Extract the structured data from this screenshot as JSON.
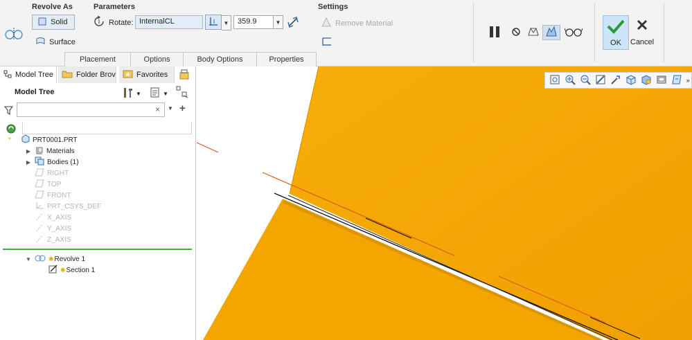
{
  "ribbon": {
    "revolve_as": {
      "title": "Revolve As",
      "solid_label": "Solid",
      "surface_label": "Surface"
    },
    "parameters": {
      "title": "Parameters",
      "rotate_label": "Rotate:",
      "axis_value": "InternalCL",
      "angle_value": "359.9"
    },
    "settings": {
      "title": "Settings",
      "remove_material_label": "Remove Material"
    },
    "tabs": [
      "Placement",
      "Options",
      "Body Options",
      "Properties"
    ],
    "ok_label": "OK",
    "cancel_label": "Cancel"
  },
  "left_panel": {
    "nav_tabs": [
      "Model Tree",
      "Folder Brov",
      "Favorites"
    ],
    "tree_title": "Model Tree",
    "filter_placeholder": "",
    "clear_symbol": "×",
    "add_symbol": "+",
    "tree": {
      "root": "PRT0001.PRT",
      "materials": "Materials",
      "bodies": "Bodies (1)",
      "right": "RIGHT",
      "top": "TOP",
      "front": "FRONT",
      "csys": "PRT_CSYS_DEF",
      "x_axis": "X_AXIS",
      "y_axis": "Y_AXIS",
      "z_axis": "Z_AXIS",
      "revolve": "Revolve 1",
      "section": "Section 1"
    }
  },
  "colors": {
    "part_fill": "#f5a800",
    "part_shadow": "#d88f00",
    "ok_bg": "#cde6f7",
    "ok_check": "#2e9a38",
    "insert_line": "#3fae3f",
    "ref_line": "#e25a1c"
  }
}
